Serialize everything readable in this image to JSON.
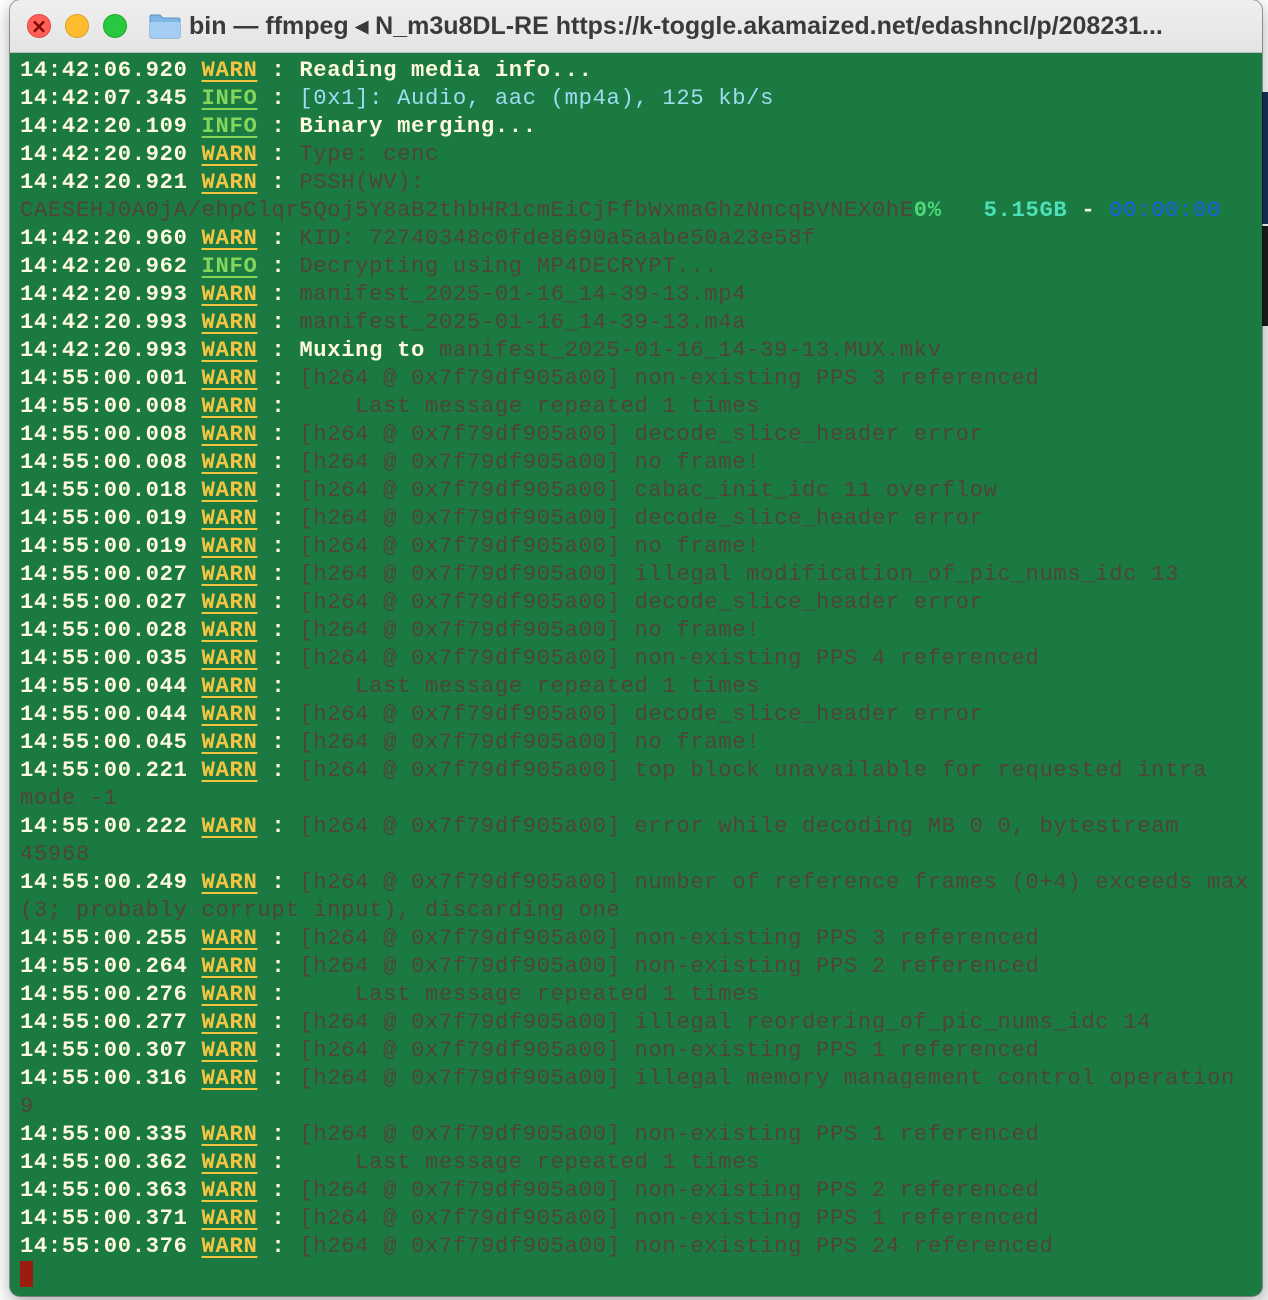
{
  "window": {
    "title": "bin — ffmpeg ◂ N_m3u8DL-RE https://k-toggle.akamaized.net/edashncl/p/208231...",
    "close_icon": "close-icon",
    "minimize_icon": "minimize-icon",
    "maximize_icon": "maximize-icon",
    "folder_icon": "folder-icon"
  },
  "colors": {
    "terminal_bg": "#1a7a42",
    "warn": "#f5c542",
    "info": "#84d65a",
    "cursor": "#9c1c10"
  },
  "log": [
    {
      "time": "14:42:06.920",
      "level": "WARN",
      "msg": "Reading media info...",
      "style": "bright"
    },
    {
      "time": "14:42:07.345",
      "level": "INFO",
      "msg": "[0x1]: Audio, aac (mp4a), 125 kb/s",
      "style": "cyan"
    },
    {
      "time": "14:42:20.109",
      "level": "INFO",
      "msg": "Binary merging...",
      "style": "bright"
    },
    {
      "time": "14:42:20.920",
      "level": "WARN",
      "msg": "Type: cenc",
      "style": "dim"
    },
    {
      "time": "14:42:20.921",
      "level": "WARN",
      "msg": "PSSH(WV):",
      "style": "dim"
    },
    {
      "continuation": "CAESEHJ0A0jA/ehpClqr5Qoj5Y8aB2thbHR1cmEiCjFfbWxmaGhzNncqBVNEX0hE",
      "progress_pct": "0%",
      "progress_size": "5.15GB",
      "progress_sep": "-",
      "progress_time": "00:00:00"
    },
    {
      "time": "14:42:20.960",
      "level": "WARN",
      "msg": "KID: 72740348c0fde8690a5aabe50a23e58f",
      "style": "dim"
    },
    {
      "time": "14:42:20.962",
      "level": "INFO",
      "msg": "Decrypting using MP4DECRYPT...",
      "style": "dim"
    },
    {
      "time": "14:42:20.993",
      "level": "WARN",
      "msg": "manifest_2025-01-16_14-39-13.mp4",
      "style": "dim"
    },
    {
      "time": "14:42:20.993",
      "level": "WARN",
      "msg": "manifest_2025-01-16_14-39-13.m4a",
      "style": "dim"
    },
    {
      "time": "14:42:20.993",
      "level": "WARN",
      "msg_bright": "Muxing to",
      "msg": "manifest_2025-01-16_14-39-13.MUX.mkv",
      "style": "dim"
    },
    {
      "time": "14:55:00.001",
      "level": "WARN",
      "msg": "[h264 @ 0x7f79df905a00] non-existing PPS 3 referenced",
      "style": "dim"
    },
    {
      "time": "14:55:00.008",
      "level": "WARN",
      "msg": "    Last message repeated 1 times",
      "style": "dim"
    },
    {
      "time": "14:55:00.008",
      "level": "WARN",
      "msg": "[h264 @ 0x7f79df905a00] decode_slice_header error",
      "style": "dim"
    },
    {
      "time": "14:55:00.008",
      "level": "WARN",
      "msg": "[h264 @ 0x7f79df905a00] no frame!",
      "style": "dim"
    },
    {
      "time": "14:55:00.018",
      "level": "WARN",
      "msg": "[h264 @ 0x7f79df905a00] cabac_init_idc 11 overflow",
      "style": "dim"
    },
    {
      "time": "14:55:00.019",
      "level": "WARN",
      "msg": "[h264 @ 0x7f79df905a00] decode_slice_header error",
      "style": "dim"
    },
    {
      "time": "14:55:00.019",
      "level": "WARN",
      "msg": "[h264 @ 0x7f79df905a00] no frame!",
      "style": "dim"
    },
    {
      "time": "14:55:00.027",
      "level": "WARN",
      "msg": "[h264 @ 0x7f79df905a00] illegal modification_of_pic_nums_idc 13",
      "style": "dim"
    },
    {
      "time": "14:55:00.027",
      "level": "WARN",
      "msg": "[h264 @ 0x7f79df905a00] decode_slice_header error",
      "style": "dim"
    },
    {
      "time": "14:55:00.028",
      "level": "WARN",
      "msg": "[h264 @ 0x7f79df905a00] no frame!",
      "style": "dim"
    },
    {
      "time": "14:55:00.035",
      "level": "WARN",
      "msg": "[h264 @ 0x7f79df905a00] non-existing PPS 4 referenced",
      "style": "dim"
    },
    {
      "time": "14:55:00.044",
      "level": "WARN",
      "msg": "    Last message repeated 1 times",
      "style": "dim"
    },
    {
      "time": "14:55:00.044",
      "level": "WARN",
      "msg": "[h264 @ 0x7f79df905a00] decode_slice_header error",
      "style": "dim"
    },
    {
      "time": "14:55:00.045",
      "level": "WARN",
      "msg": "[h264 @ 0x7f79df905a00] no frame!",
      "style": "dim"
    },
    {
      "time": "14:55:00.221",
      "level": "WARN",
      "msg": "[h264 @ 0x7f79df905a00] top block unavailable for requested intra",
      "style": "dim"
    },
    {
      "continuation_dim": "mode -1"
    },
    {
      "time": "14:55:00.222",
      "level": "WARN",
      "msg": "[h264 @ 0x7f79df905a00] error while decoding MB 0 0, bytestream",
      "style": "dim"
    },
    {
      "continuation_dim": "45968"
    },
    {
      "time": "14:55:00.249",
      "level": "WARN",
      "msg": "[h264 @ 0x7f79df905a00] number of reference frames (0+4) exceeds max",
      "style": "dim"
    },
    {
      "continuation_dim": "(3; probably corrupt input), discarding one"
    },
    {
      "time": "14:55:00.255",
      "level": "WARN",
      "msg": "[h264 @ 0x7f79df905a00] non-existing PPS 3 referenced",
      "style": "dim"
    },
    {
      "time": "14:55:00.264",
      "level": "WARN",
      "msg": "[h264 @ 0x7f79df905a00] non-existing PPS 2 referenced",
      "style": "dim"
    },
    {
      "time": "14:55:00.276",
      "level": "WARN",
      "msg": "    Last message repeated 1 times",
      "style": "dim"
    },
    {
      "time": "14:55:00.277",
      "level": "WARN",
      "msg": "[h264 @ 0x7f79df905a00] illegal reordering_of_pic_nums_idc 14",
      "style": "dim"
    },
    {
      "time": "14:55:00.307",
      "level": "WARN",
      "msg": "[h264 @ 0x7f79df905a00] non-existing PPS 1 referenced",
      "style": "dim"
    },
    {
      "time": "14:55:00.316",
      "level": "WARN",
      "msg": "[h264 @ 0x7f79df905a00] illegal memory management control operation",
      "style": "dim"
    },
    {
      "continuation_dim": "9"
    },
    {
      "time": "14:55:00.335",
      "level": "WARN",
      "msg": "[h264 @ 0x7f79df905a00] non-existing PPS 1 referenced",
      "style": "dim"
    },
    {
      "time": "14:55:00.362",
      "level": "WARN",
      "msg": "    Last message repeated 1 times",
      "style": "dim"
    },
    {
      "time": "14:55:00.363",
      "level": "WARN",
      "msg": "[h264 @ 0x7f79df905a00] non-existing PPS 2 referenced",
      "style": "dim"
    },
    {
      "time": "14:55:00.371",
      "level": "WARN",
      "msg": "[h264 @ 0x7f79df905a00] non-existing PPS 1 referenced",
      "style": "dim"
    },
    {
      "time": "14:55:00.376",
      "level": "WARN",
      "msg": "[h264 @ 0x7f79df905a00] non-existing PPS 24 referenced",
      "style": "dim"
    }
  ]
}
